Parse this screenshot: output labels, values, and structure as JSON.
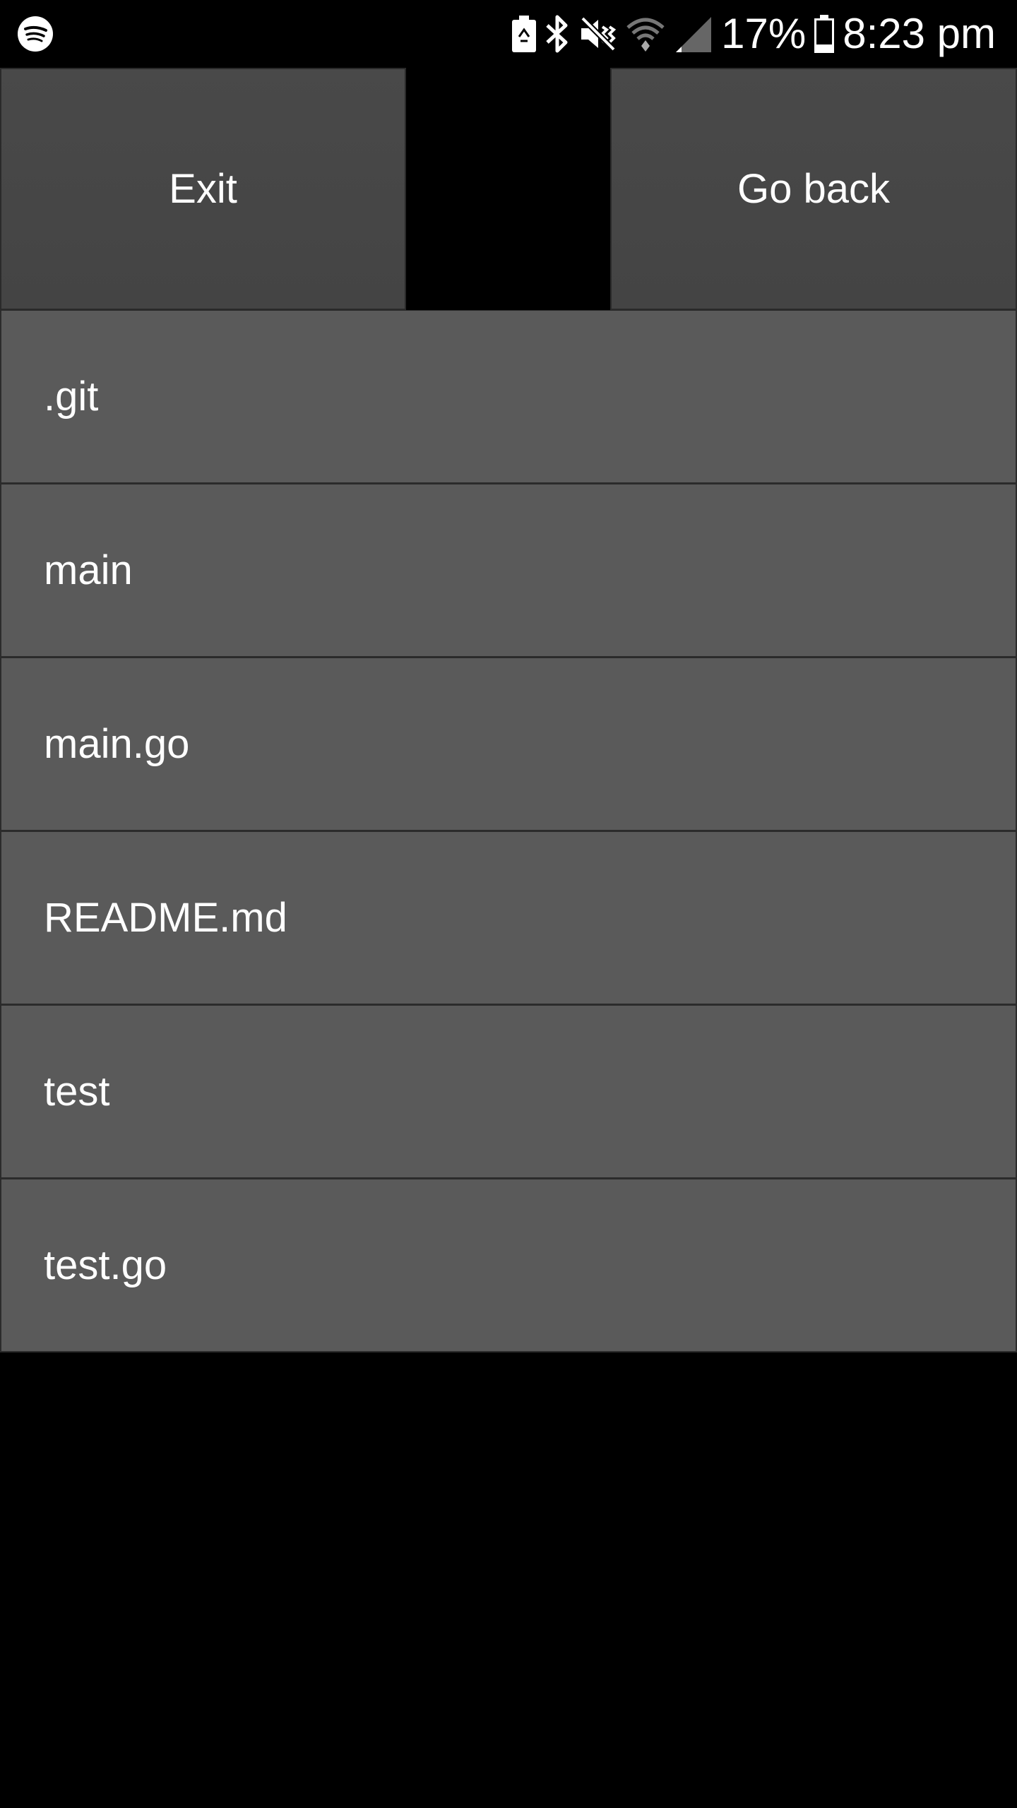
{
  "status_bar": {
    "icons": [
      "spotify-icon",
      "battery-saver-icon",
      "bluetooth-icon",
      "vibrate-mute-icon",
      "wifi-icon",
      "signal-icon",
      "battery-icon"
    ],
    "battery_percent": "17%",
    "time": "8:23 pm"
  },
  "toolbar": {
    "exit_label": "Exit",
    "back_label": "Go back"
  },
  "files": [
    {
      "name": ".git"
    },
    {
      "name": "main"
    },
    {
      "name": "main.go"
    },
    {
      "name": "README.md"
    },
    {
      "name": "test"
    },
    {
      "name": "test.go"
    }
  ],
  "colors": {
    "background": "#000000",
    "button": "#474747",
    "list_item": "#5a5a5a",
    "text": "#ffffff"
  }
}
